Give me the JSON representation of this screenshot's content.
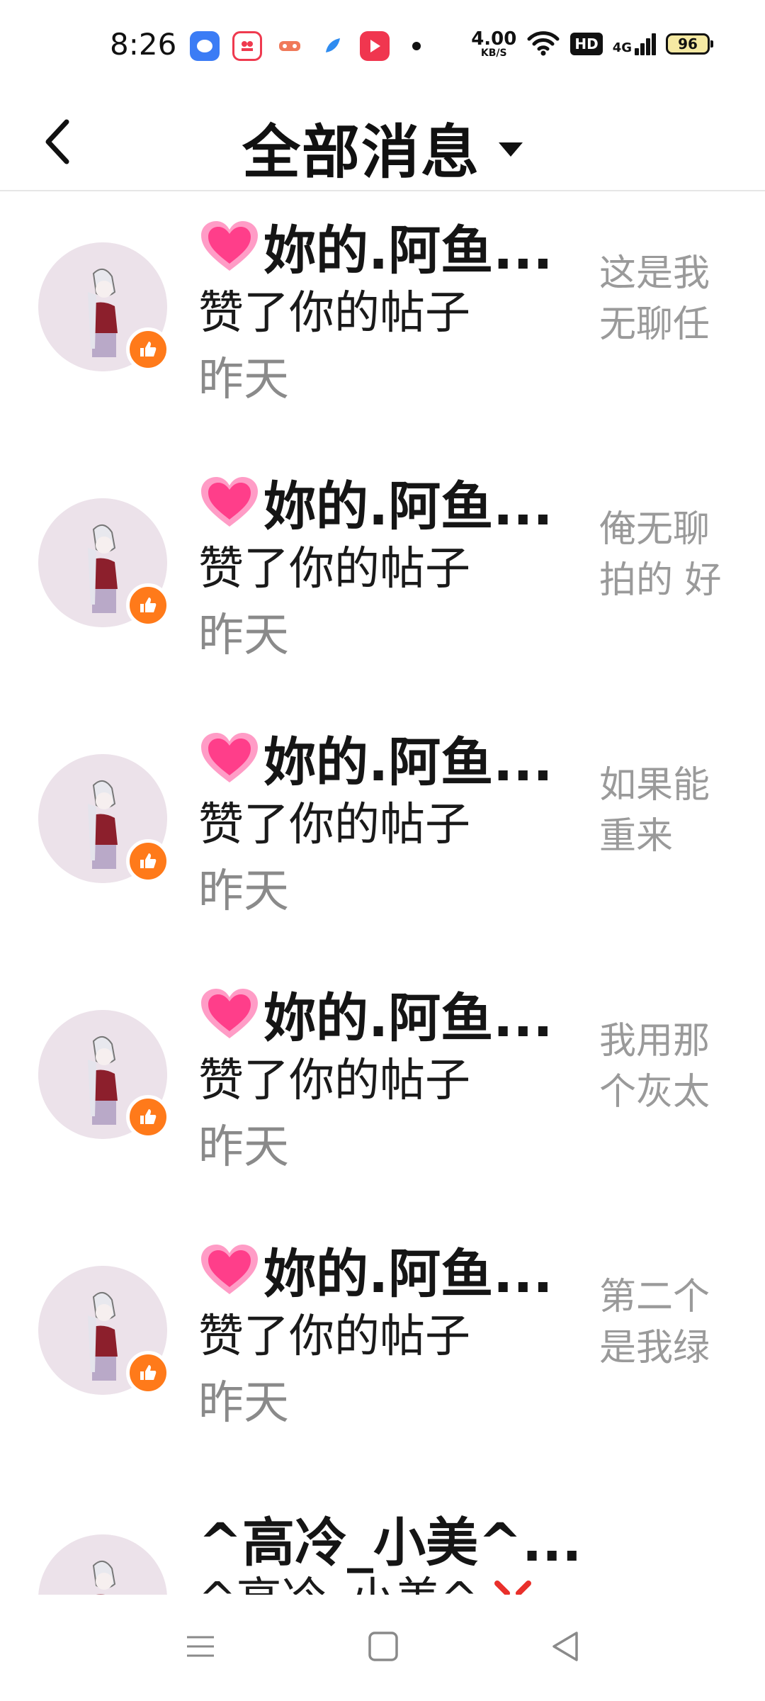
{
  "status_bar": {
    "time": "8:26",
    "net_speed_value": "4.00",
    "net_speed_unit": "KB/S",
    "hd_label": "HD",
    "signal_label": "4G",
    "battery_level": "96"
  },
  "header": {
    "title": "全部消息"
  },
  "notifications": [
    {
      "name": "妳的.阿鱼...",
      "action": "赞了你的帖子",
      "time": "昨天",
      "preview": "这是我无聊任务就"
    },
    {
      "name": "妳的.阿鱼...",
      "action": "赞了你的帖子",
      "time": "昨天",
      "preview": "俺无聊拍的 好看吗"
    },
    {
      "name": "妳的.阿鱼...",
      "action": "赞了你的帖子",
      "time": "昨天",
      "preview": "如果能重来"
    },
    {
      "name": "妳的.阿鱼...",
      "action": "赞了你的帖子",
      "time": "昨天",
      "preview": "我用那个灰太狼就"
    },
    {
      "name": "妳的.阿鱼...",
      "action": "赞了你的帖子",
      "time": "昨天",
      "preview": "第二个是我绿了是"
    },
    {
      "name": "^高冷_小美^...",
      "action": "^高冷_小美^"
    }
  ],
  "icons": {
    "back": "chevron-left-icon",
    "dropdown": "caret-down-icon",
    "heart": "heart-icon",
    "like": "thumbs-up-icon",
    "nav_menu": "menu-icon",
    "nav_home": "square-icon",
    "nav_back": "triangle-back-icon"
  },
  "colors": {
    "like_badge": "#ff7a1a",
    "heart": "#ff3e8a",
    "avatar_bg": "#ece2ea",
    "preview_text": "#9a9a9a",
    "time_text": "#8a8a8a"
  }
}
